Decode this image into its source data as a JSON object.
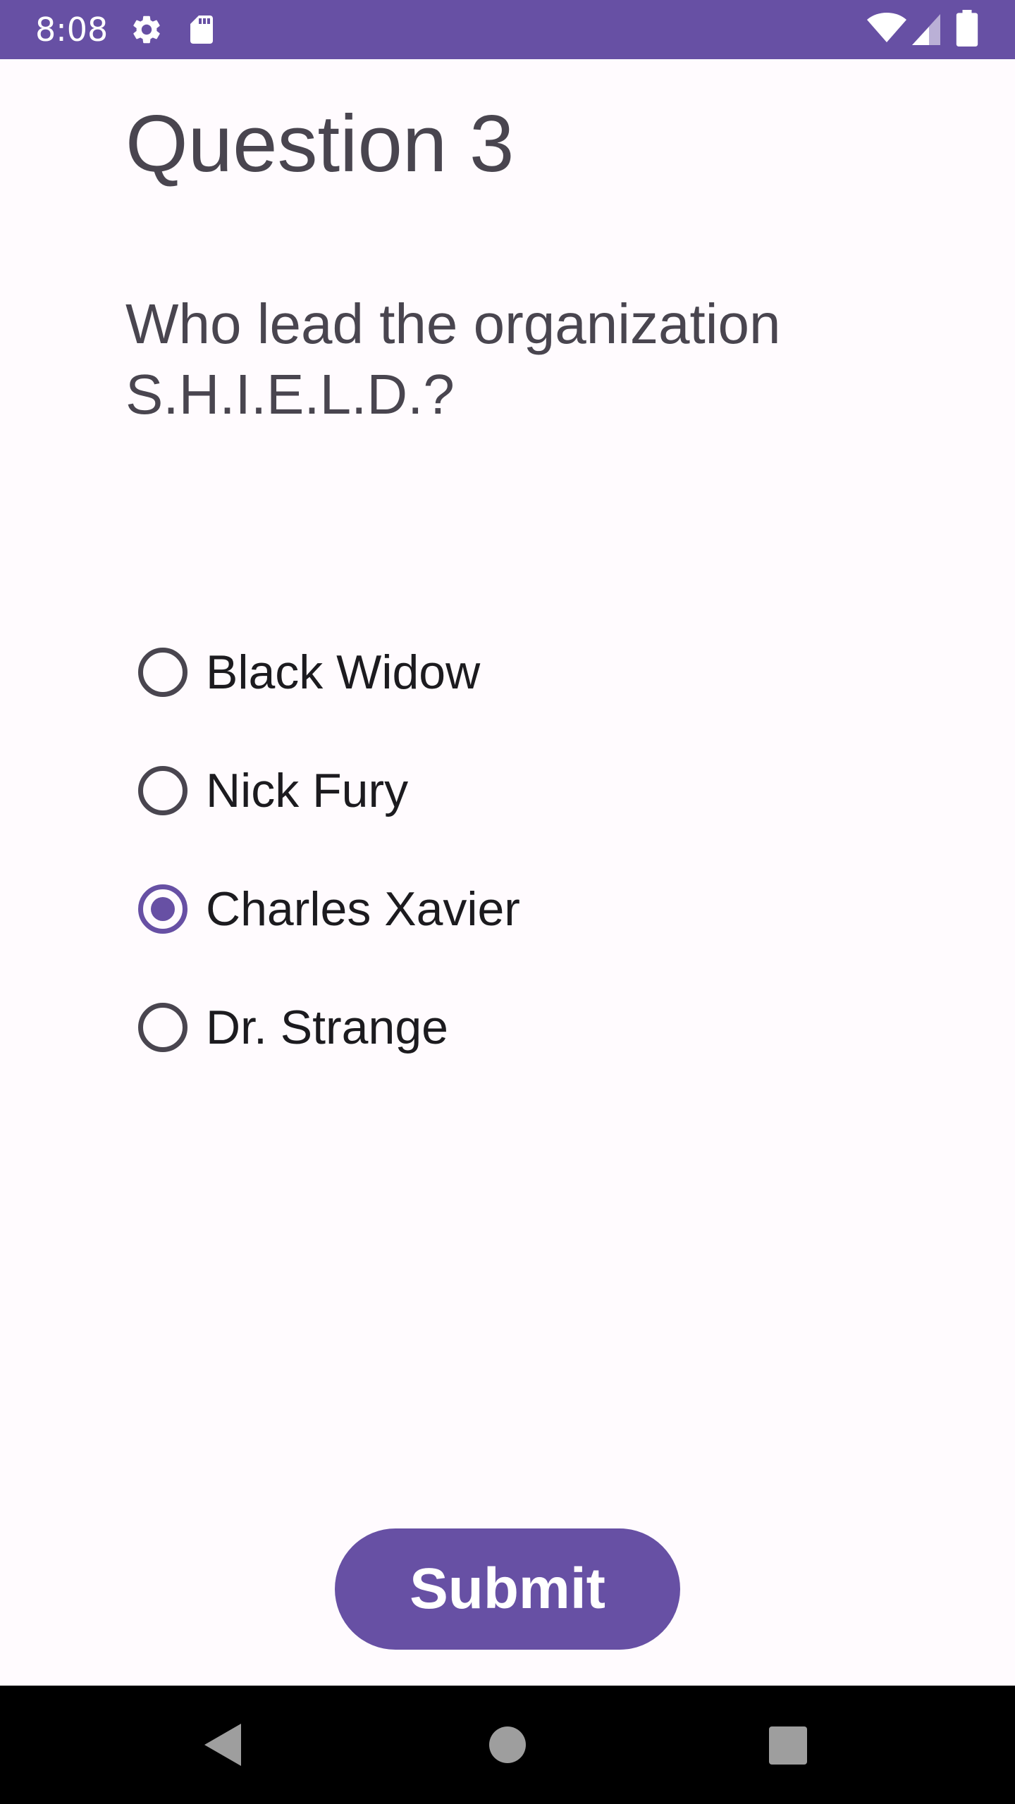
{
  "status_bar": {
    "time": "8:08",
    "left_icons": [
      "gear-icon",
      "sd-card-icon"
    ],
    "right_icons": [
      "wifi-icon",
      "cell-signal-icon",
      "battery-icon"
    ],
    "background": "#6750A4"
  },
  "quiz": {
    "title": "Question 3",
    "question": "Who lead the organization S.H.I.E.L.D.?",
    "options": [
      {
        "label": "Black Widow",
        "selected": false
      },
      {
        "label": "Nick Fury",
        "selected": false
      },
      {
        "label": "Charles Xavier",
        "selected": true
      },
      {
        "label": "Dr. Strange",
        "selected": false
      }
    ],
    "submit_label": "Submit",
    "accent_color": "#6750A4"
  },
  "nav_bar": {
    "buttons": [
      "back-icon",
      "home-icon",
      "recents-icon"
    ]
  }
}
